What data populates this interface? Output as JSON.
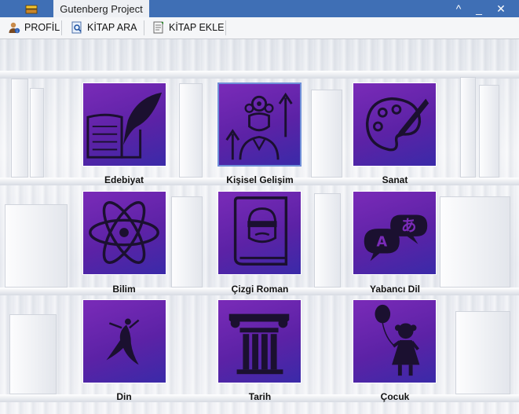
{
  "window": {
    "title": "Gutenberg Project",
    "controls": [
      "^",
      "_",
      "✕"
    ]
  },
  "toolbar": {
    "items": [
      {
        "label": "PROFİL",
        "icon": "user-icon"
      },
      {
        "label": "KİTAP ARA",
        "icon": "search-book-icon"
      },
      {
        "label": "KİTAP EKLE",
        "icon": "add-book-icon"
      }
    ]
  },
  "categories": [
    {
      "label": "Edebiyat",
      "icon": "book-quill-icon"
    },
    {
      "label": "Kişisel Gelişim",
      "icon": "personal-growth-icon"
    },
    {
      "label": "Sanat",
      "icon": "palette-icon"
    },
    {
      "label": "Bilim",
      "icon": "atom-icon"
    },
    {
      "label": "Çizgi Roman",
      "icon": "comic-book-icon"
    },
    {
      "label": "Yabancı Dil",
      "icon": "translate-icon"
    },
    {
      "label": "Din",
      "icon": "whirling-dervish-icon"
    },
    {
      "label": "Tarih",
      "icon": "column-icon"
    },
    {
      "label": "Çocuk",
      "icon": "child-balloon-icon"
    }
  ],
  "colors": {
    "titlebar": "#3f6fb5",
    "tile_top": "#7a2bb8",
    "tile_bottom": "#3a2aa8"
  }
}
